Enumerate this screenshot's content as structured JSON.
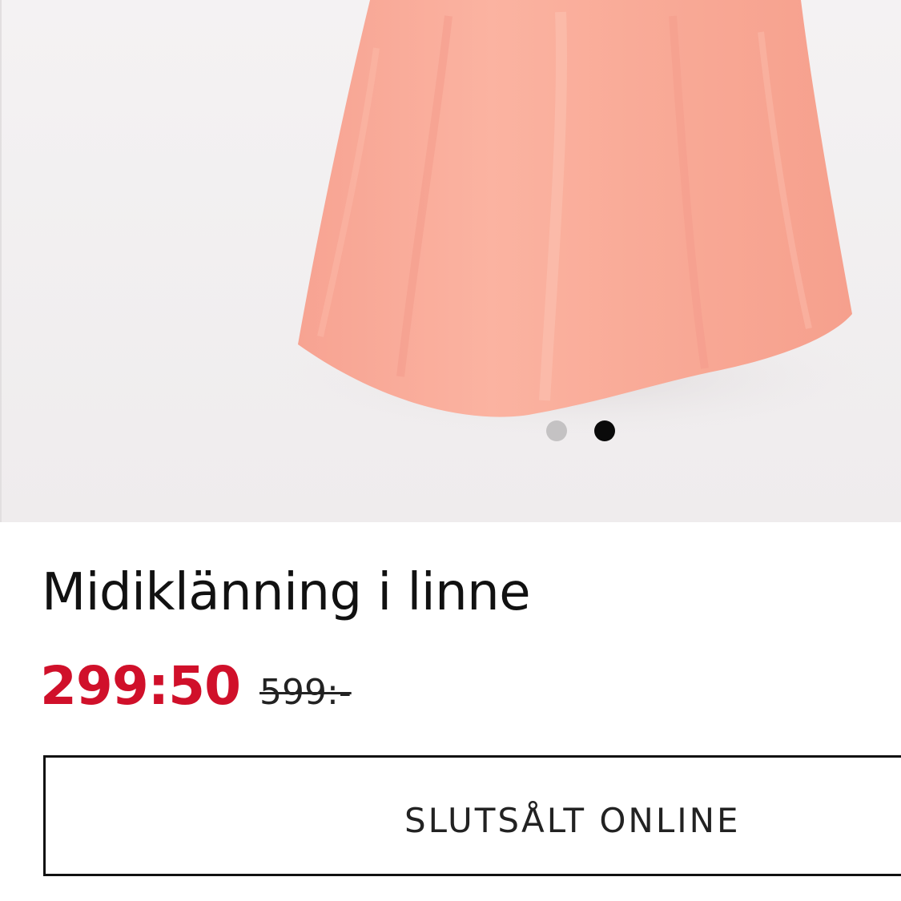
{
  "product": {
    "title": "Midiklänning i linne",
    "price_sale": "299:50",
    "price_original": "599:-",
    "status_button_label": "SLUTSÅLT ONLINE"
  },
  "carousel": {
    "slide_count": 2,
    "active_index": 1
  },
  "colors": {
    "sale_price": "#d0102a",
    "dress": "#f9a996",
    "dot_inactive": "#c4c2c3",
    "dot_active": "#0a0a0a"
  },
  "icons": {
    "carousel_dot": "filled-circle"
  }
}
